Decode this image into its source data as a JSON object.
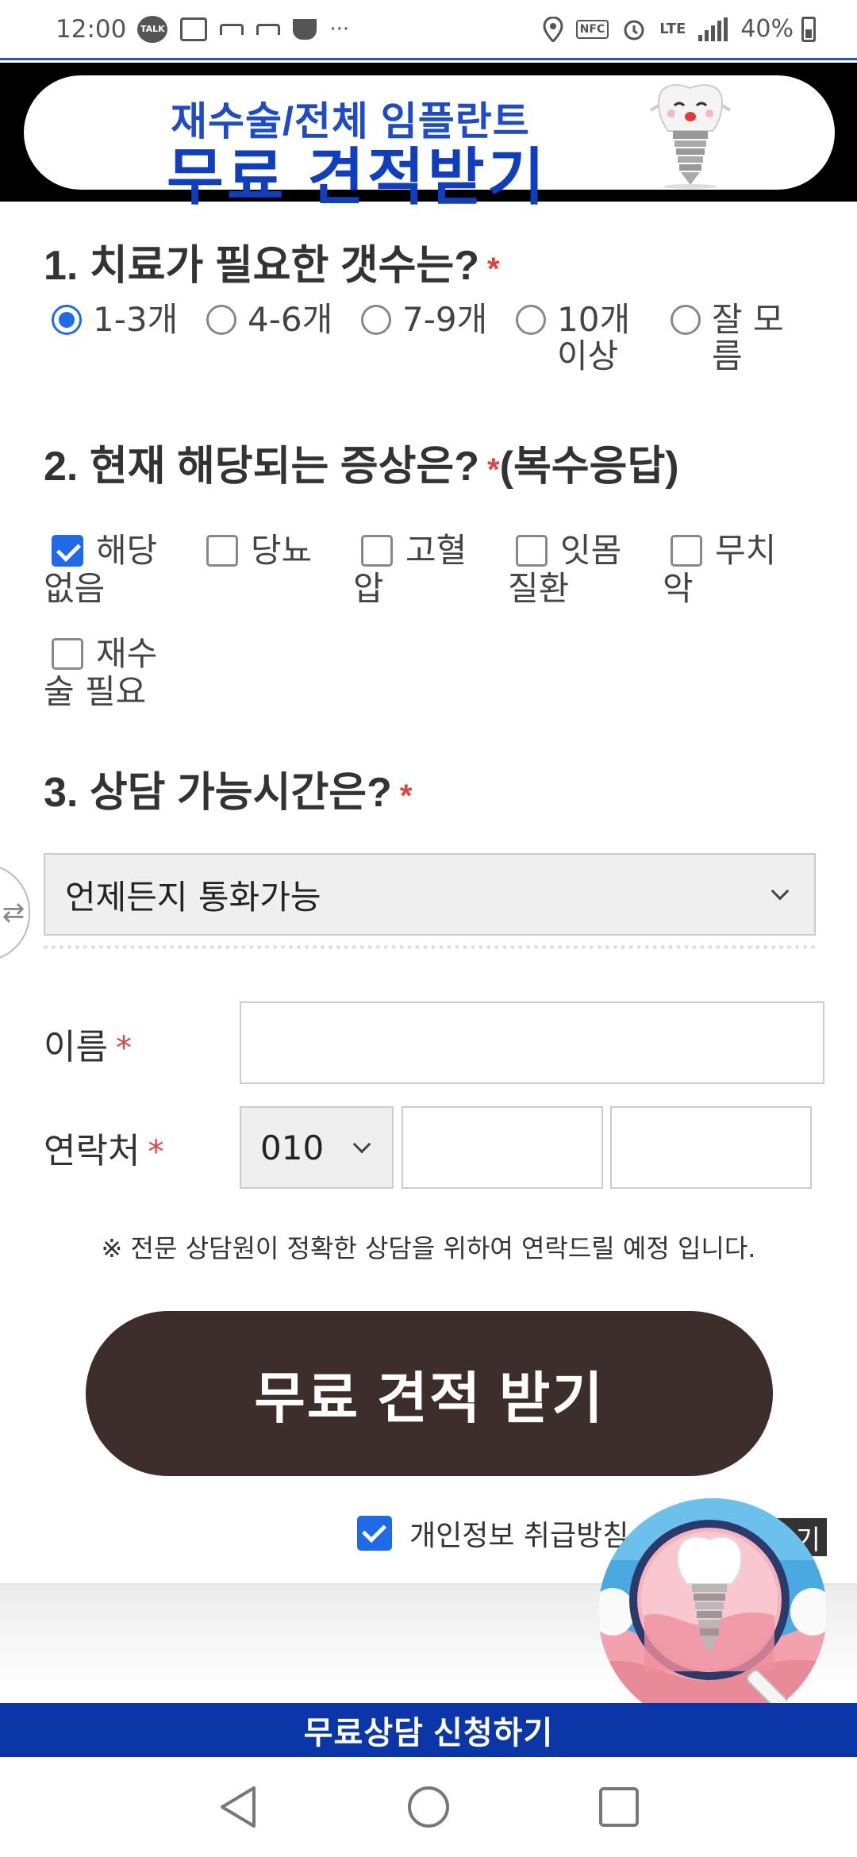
{
  "status_bar": {
    "time": "12:00",
    "talk_label": "TALK",
    "nfc_label": "NFC",
    "network": "LTE",
    "battery": "40%",
    "ellipsis": "···"
  },
  "banner": {
    "line1": "재수술/전체 임플란트",
    "line2": "무료 견적받기"
  },
  "q1": {
    "title": "1. 치료가 필요한 갯수는?",
    "required_mark": "*",
    "options": [
      "1-3개",
      "4-6개",
      "7-9개",
      "10개 이상",
      "잘 모름"
    ],
    "selected_index": 0
  },
  "q2": {
    "title": "2. 현재 해당되는 증상은?",
    "required_mark": "*",
    "suffix": "(복수응답)",
    "options": [
      "해당없음",
      "당뇨",
      "고혈압",
      "잇몸질환",
      "무치악",
      "재수술 필요"
    ],
    "checked": [
      true,
      false,
      false,
      false,
      false,
      false
    ]
  },
  "q3": {
    "title": "3. 상담 가능시간은?",
    "required_mark": "*",
    "selected_value": "언제든지 통화가능"
  },
  "form": {
    "name_label": "이름",
    "phone_label": "연락처",
    "required_mark": "*",
    "name_value": "",
    "phone_prefix": "010",
    "phone_middle": "",
    "phone_last": "",
    "notice": "※ 전문 상담원이 정확한 상담을 위하여 연락드릴 예정 입니다."
  },
  "cta_label": "무료 견적 받기",
  "privacy": {
    "label": "개인정보 취급방침",
    "checked": true,
    "view_label": "기"
  },
  "bottom_bar_label": "무료상담 신청하기",
  "side_tab_glyph": "⇄",
  "colors": {
    "banner_blue": "#0f3fbf",
    "cta_brown": "#3e2e2b",
    "bottom_bar_blue": "#0a36a8",
    "required_red": "#e0443e",
    "check_blue": "#1e6ae8"
  },
  "icons": [
    "talk-icon",
    "chat-icon",
    "notification-icon",
    "cup-icon",
    "location-icon",
    "nfc-icon",
    "alarm-icon",
    "signal-icon",
    "battery-icon",
    "swap-icon",
    "chevron-down-icon",
    "back-icon",
    "home-icon",
    "recents-icon",
    "tooth-mascot-icon",
    "implant-magnifier-icon"
  ]
}
